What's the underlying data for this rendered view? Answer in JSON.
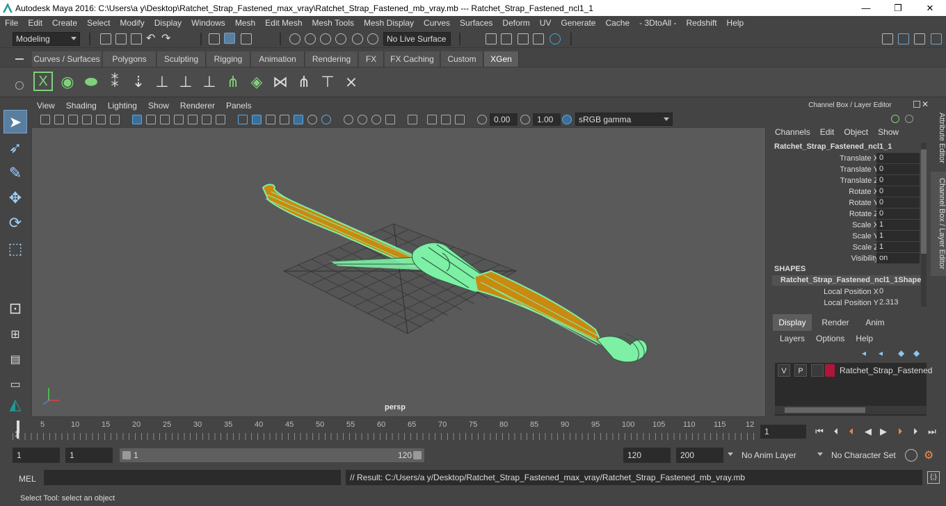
{
  "window": {
    "title": "Autodesk Maya 2016: C:\\Users\\a y\\Desktop\\Ratchet_Strap_Fastened_max_vray\\Ratchet_Strap_Fastened_mb_vray.mb   ---   Ratchet_Strap_Fastened_ncl1_1",
    "minimize": "—",
    "maximize": "❐",
    "close": "✕"
  },
  "menubar": [
    "File",
    "Edit",
    "Create",
    "Select",
    "Modify",
    "Display",
    "Windows",
    "Mesh",
    "Edit Mesh",
    "Mesh Tools",
    "Mesh Display",
    "Curves",
    "Surfaces",
    "Deform",
    "UV",
    "Generate",
    "Cache",
    "- 3DtoAll -",
    "Redshift",
    "Help"
  ],
  "statusline": {
    "mode": "Modeling",
    "live_surface": "No Live Surface"
  },
  "shelf": {
    "tabs": [
      "Curves / Surfaces",
      "Polygons",
      "Sculpting",
      "Rigging",
      "Animation",
      "Rendering",
      "FX",
      "FX Caching",
      "Custom",
      "XGen"
    ],
    "active_tab": "XGen"
  },
  "viewport": {
    "menu": [
      "View",
      "Shading",
      "Lighting",
      "Show",
      "Renderer",
      "Panels"
    ],
    "field_a": "0.00",
    "field_b": "1.00",
    "color_space": "sRGB gamma",
    "camera": "persp"
  },
  "channel_box": {
    "header": "Channel Box / Layer Editor",
    "menu": [
      "Channels",
      "Edit",
      "Object",
      "Show"
    ],
    "object": "Ratchet_Strap_Fastened_ncl1_1",
    "attributes": [
      {
        "label": "Translate X",
        "value": "0"
      },
      {
        "label": "Translate Y",
        "value": "0"
      },
      {
        "label": "Translate Z",
        "value": "0"
      },
      {
        "label": "Rotate X",
        "value": "0"
      },
      {
        "label": "Rotate Y",
        "value": "0"
      },
      {
        "label": "Rotate Z",
        "value": "0"
      },
      {
        "label": "Scale X",
        "value": "1"
      },
      {
        "label": "Scale Y",
        "value": "1"
      },
      {
        "label": "Scale Z",
        "value": "1"
      },
      {
        "label": "Visibility",
        "value": "on"
      }
    ],
    "shapes_label": "SHAPES",
    "shape_name": "Ratchet_Strap_Fastened_ncl1_1Shape",
    "shape_attributes": [
      {
        "label": "Local Position X",
        "value": "0"
      },
      {
        "label": "Local Position Y",
        "value": "2.313"
      }
    ]
  },
  "side_tabs": [
    "Attribute Editor",
    "Channel Box / Layer Editor"
  ],
  "layer_editor": {
    "tabs": [
      "Display",
      "Render",
      "Anim"
    ],
    "active_tab": "Display",
    "menu": [
      "Layers",
      "Options",
      "Help"
    ],
    "layer": {
      "v": "V",
      "p": "P",
      "name": "Ratchet_Strap_Fastened",
      "color": "#b0153a"
    }
  },
  "time_slider": {
    "ticks": [
      "5",
      "10",
      "15",
      "20",
      "25",
      "30",
      "35",
      "40",
      "45",
      "50",
      "55",
      "60",
      "65",
      "70",
      "75",
      "80",
      "85",
      "90",
      "95",
      "100",
      "105",
      "110",
      "115",
      "12"
    ],
    "current_frame_marker": "1",
    "current_frame": "1"
  },
  "range": {
    "start": "1",
    "playback_start": "1",
    "slider_start": "1",
    "slider_end": "120",
    "playback_end": "120",
    "end": "200",
    "anim_layer": "No Anim Layer",
    "character_set": "No Character Set"
  },
  "command_line": {
    "label": "MEL",
    "result": "// Result: C:/Users/a y/Desktop/Ratchet_Strap_Fastened_max_vray/Ratchet_Strap_Fastened_mb_vray.mb"
  },
  "help_line": "Select Tool: select an object",
  "colors": {
    "wireframe": "#7df0a6",
    "strap_fill": "#c98a10",
    "accent_blue": "#5a7ea0"
  }
}
